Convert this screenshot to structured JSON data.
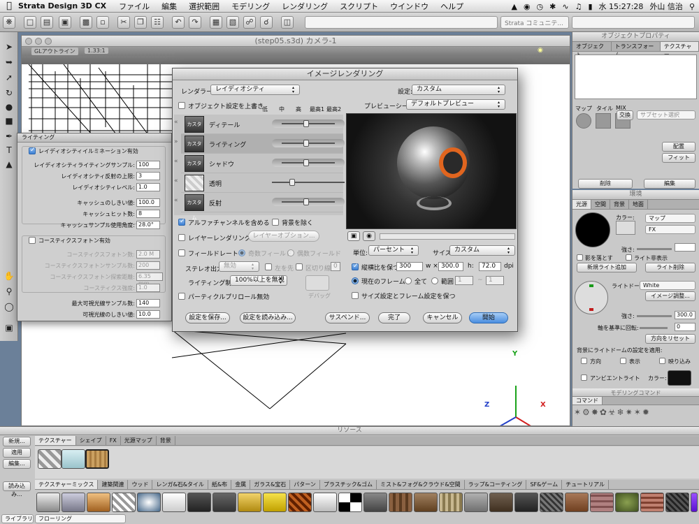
{
  "menubar": {
    "app": "Strata Design 3D CX",
    "items": [
      "ファイル",
      "編集",
      "選択範囲",
      "モデリング",
      "レンダリング",
      "スクリプト",
      "ウインドウ",
      "ヘルプ"
    ],
    "clock": "水 15:27:28",
    "user": "外山 信治"
  },
  "toolbar": {
    "community": "Strata コミュニテ..."
  },
  "camera_window": {
    "title": "(step05.s3d) カメラ-1",
    "view_mode": "GLアウトライン",
    "zoom": "1.33:1"
  },
  "axes": {
    "y": "Y",
    "x": "X",
    "z": "Z"
  },
  "object_props": {
    "title": "オブジェクトプロパティ",
    "tabs": [
      "オブジェクト",
      "トランスフォーム",
      "テクスチャー"
    ],
    "sub_labels": [
      "マップ",
      "タイル",
      "MIX"
    ],
    "swap": "交換",
    "subset_select": "サブセット選択",
    "place_btn": "配置",
    "fit_btn": "フィット",
    "delete_btn": "削除",
    "edit_btn": "編集"
  },
  "environment": {
    "title": "環境",
    "tabs": [
      "光源",
      "空間",
      "背景",
      "地面"
    ],
    "color_label": "カラー:",
    "map_select": "マップ",
    "fx_select": "FX",
    "strength_label": "強さ:",
    "shadow_cb": "影を落とす",
    "hide_light_cb": "ライト非表示",
    "new_light_btn": "新規ライト追加",
    "delete_light_btn": "ライト削除",
    "light_dome_label": "ライトドーム:",
    "light_dome_value": "White",
    "image_adjust_btn": "イメージ調整...",
    "strength2_label": "強さ:",
    "strength2_value": "300.0",
    "axis_rotate_label": "軸を基準に回転:",
    "axis_rotate_value": "0",
    "direction_reset_btn": "方向をリセット",
    "apply_bg_label": "背景にライトドームの設定を適用:",
    "cb_direction": "方向",
    "cb_display": "表示",
    "cb_reflection": "映り込み",
    "ambient_cb": "アンビエントライト",
    "ambient_color_label": "カラー:"
  },
  "modeling_cmd": {
    "title": "モデリングコマンド",
    "tab": "コマンド"
  },
  "lighting_panel": {
    "title": "ライティング",
    "radiosity_cb": "レイディオシティイルミネーション有効",
    "rows": [
      {
        "label": "レイディオシティライティングサンプル:",
        "value": "100"
      },
      {
        "label": "レイディオシティ反射の上限:",
        "value": "3"
      },
      {
        "label": "レイディオシティレベル:",
        "value": "1.0"
      }
    ],
    "cache_rows": [
      {
        "label": "キャッシュのしきい値:",
        "value": "100.0"
      },
      {
        "label": "キャッシュヒット数:",
        "value": "8"
      },
      {
        "label": "キャッシュサンプル使用角度:",
        "value": "28.0°"
      }
    ],
    "caustics_cb": "コースティクスフォトン有効",
    "caustic_rows": [
      {
        "label": "コースティクスフォトン数:",
        "value": "2.0 M"
      },
      {
        "label": "コースティクスフォトンサンプル数:",
        "value": "200"
      },
      {
        "label": "コースティクスフォトン探索距離:",
        "value": "6.35 mm"
      },
      {
        "label": "コースティクス強度:",
        "value": "1.0"
      }
    ],
    "max_rays_label": "最大可視光線サンプル数:",
    "max_rays_value": "140",
    "vis_threshold_label": "可視光線のしきい値:",
    "vis_threshold_value": "10.0"
  },
  "render_dialog": {
    "title": "イメージレンダリング",
    "renderer_label": "レンダラー:",
    "renderer_value": "レイディオシティ",
    "settings_label": "設定:",
    "settings_value": "カスタム",
    "override_cb": "オブジェクト設定を上書き",
    "quality_heads": [
      "低",
      "中",
      "高",
      "最高1",
      "最高2"
    ],
    "badge": "カスタム",
    "quality_rows": [
      "ディテール",
      "ライティング",
      "シャドウ",
      "透明",
      "反射"
    ],
    "preview_label": "プレビューシーン:",
    "preview_value": "デフォルトプレビュー",
    "alpha_cb": "アルファチャンネルを含める",
    "remove_bg_cb": "背景を除く",
    "layer_render_cb": "レイヤーレンダリング",
    "layer_options_btn": "レイヤーオプション...",
    "field_rate_cb": "フィールドレート",
    "odd_field": "奇数フィールド",
    "even_field": "偶数フィールド",
    "stereo_label": "ステレオ出力:",
    "stereo_value": "無効",
    "left_right_cb": "左を先",
    "divider_cb": "区切り線",
    "divider_value": "0",
    "lighting_ctrl_label": "ライティング制御:",
    "lighting_ctrl_value": "100%以上を無視",
    "debug_label": "デバッグ",
    "particle_cb": "パーティクルプリロール無効",
    "unit_label": "単位:",
    "unit_value": "パーセント",
    "size_label": "サイズ:",
    "size_value": "カスタム",
    "aspect_cb": "縦横比を保つ",
    "w_value": "300",
    "w_label": "w ×",
    "h_value": "300.0",
    "h_label": "h:",
    "dpi_value": "72.0",
    "dpi_label": "dpi",
    "current_frame": "現在のフレーム",
    "all_frames": "全て",
    "range": "範囲",
    "range_from": "1",
    "range_sep": "~",
    "range_to": "1",
    "keep_size_cb": "サイズ設定とフレーム設定を保つ",
    "save_btn": "設定を保存...",
    "load_btn": "設定を読み込み...",
    "suspend_btn": "サスペンド...",
    "done_btn": "完了",
    "cancel_btn": "キャンセル",
    "start_btn": "開始"
  },
  "resources": {
    "title": "リソース",
    "new_btn": "新規...",
    "apply_btn": "適用",
    "edit_btn": "編集...",
    "load_btn": "読み込み...",
    "tabs": [
      "テクスチャー",
      "シェイプ",
      "FX",
      "光源マップ",
      "背景"
    ],
    "categories": [
      "テクスチャーミックス",
      "建築関連",
      "ウッド",
      "レンガ&石&タイル",
      "紙&布",
      "金属",
      "ガラス&宝石",
      "パターン",
      "プラスチック&ゴム",
      "ミスト&フォグ&クラウド&空間",
      "ラップ&コーティング",
      "SF&ゲーム",
      "チュートリアル"
    ],
    "library_label": "ライブラリ",
    "library_value": "フローリング"
  }
}
